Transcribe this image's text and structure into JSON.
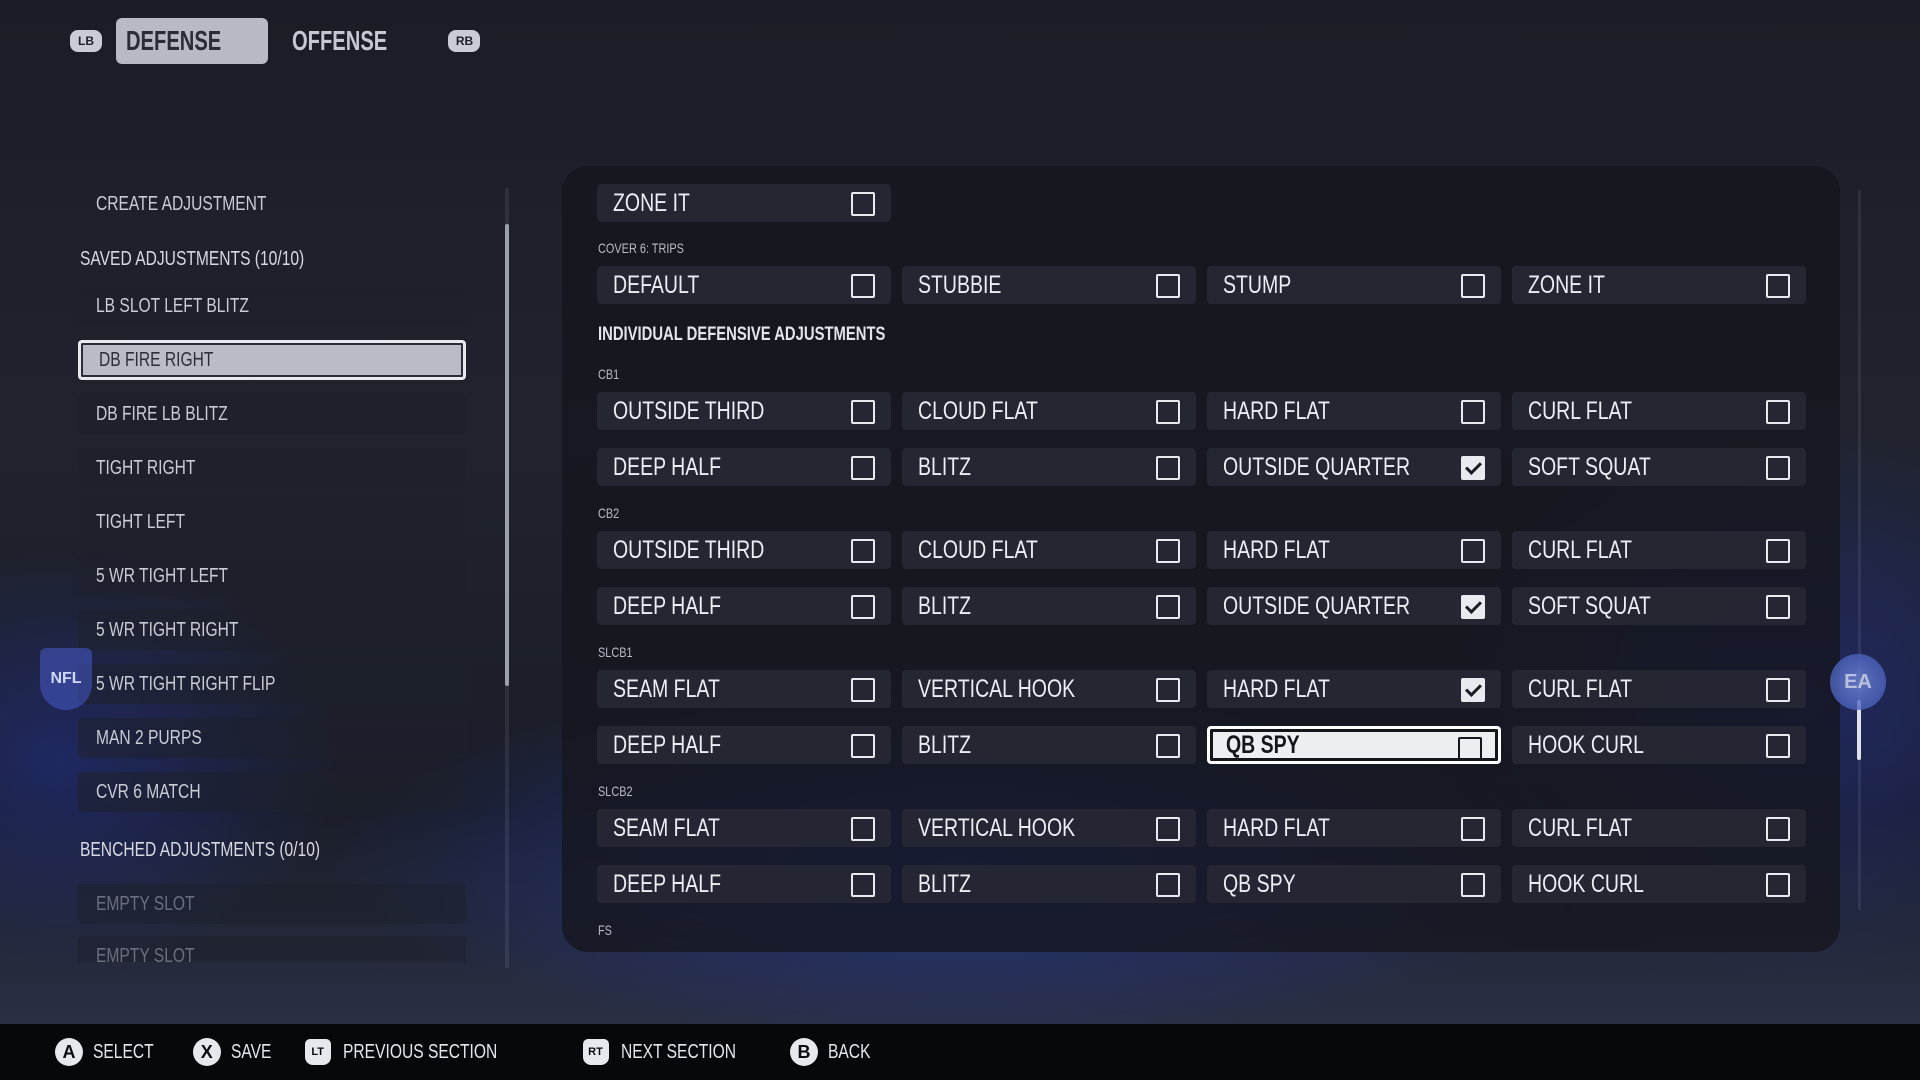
{
  "top_tabs": {
    "lb": "LB",
    "rb": "RB",
    "defense": "DEFENSE",
    "offense": "OFFENSE"
  },
  "left": {
    "create": "CREATE ADJUSTMENT",
    "saved_header": "SAVED ADJUSTMENTS (10/10)",
    "saved": [
      "LB SLOT LEFT BLITZ",
      "DB FIRE RIGHT",
      "DB FIRE LB BLITZ",
      "TIGHT RIGHT",
      "TIGHT LEFT",
      "5 WR TIGHT LEFT",
      "5 WR TIGHT RIGHT",
      "5 WR TIGHT RIGHT FLIP",
      "MAN 2 PURPS",
      "CVR 6 MATCH"
    ],
    "selected": "DB FIRE RIGHT",
    "benched_header": "BENCHED ADJUSTMENTS (0/10)",
    "benched": [
      "EMPTY SLOT",
      "EMPTY SLOT"
    ]
  },
  "main": {
    "r0": [
      {
        "label": "ZONE IT",
        "checked": false
      }
    ],
    "sec_cover6": "COVER 6: TRIPS",
    "r1": [
      {
        "label": "DEFAULT",
        "checked": false
      },
      {
        "label": "STUBBIE",
        "checked": false
      },
      {
        "label": "STUMP",
        "checked": false
      },
      {
        "label": "ZONE IT",
        "checked": false
      }
    ],
    "indiv_header": "INDIVIDUAL DEFENSIVE ADJUSTMENTS",
    "sec_cb1": "CB1",
    "r2": [
      {
        "label": "OUTSIDE THIRD",
        "checked": false
      },
      {
        "label": "CLOUD FLAT",
        "checked": false
      },
      {
        "label": "HARD FLAT",
        "checked": false
      },
      {
        "label": "CURL FLAT",
        "checked": false
      }
    ],
    "r3": [
      {
        "label": "DEEP HALF",
        "checked": false
      },
      {
        "label": "BLITZ",
        "checked": false
      },
      {
        "label": "OUTSIDE QUARTER",
        "checked": true
      },
      {
        "label": "SOFT SQUAT",
        "checked": false
      }
    ],
    "sec_cb2": "CB2",
    "r4": [
      {
        "label": "OUTSIDE THIRD",
        "checked": false
      },
      {
        "label": "CLOUD FLAT",
        "checked": false
      },
      {
        "label": "HARD FLAT",
        "checked": false
      },
      {
        "label": "CURL FLAT",
        "checked": false
      }
    ],
    "r5": [
      {
        "label": "DEEP HALF",
        "checked": false
      },
      {
        "label": "BLITZ",
        "checked": false
      },
      {
        "label": "OUTSIDE QUARTER",
        "checked": true
      },
      {
        "label": "SOFT SQUAT",
        "checked": false
      }
    ],
    "sec_slcb1": "SLCB1",
    "r6": [
      {
        "label": "SEAM FLAT",
        "checked": false
      },
      {
        "label": "VERTICAL HOOK",
        "checked": false
      },
      {
        "label": "HARD FLAT",
        "checked": true
      },
      {
        "label": "CURL FLAT",
        "checked": false
      }
    ],
    "r7": [
      {
        "label": "DEEP HALF",
        "checked": false
      },
      {
        "label": "BLITZ",
        "checked": false
      },
      {
        "label": "QB SPY",
        "checked": false
      },
      {
        "label": "HOOK CURL",
        "checked": false
      }
    ],
    "sec_slcb2": "SLCB2",
    "r8": [
      {
        "label": "SEAM FLAT",
        "checked": false
      },
      {
        "label": "VERTICAL HOOK",
        "checked": false
      },
      {
        "label": "HARD FLAT",
        "checked": false
      },
      {
        "label": "CURL FLAT",
        "checked": false
      }
    ],
    "r9": [
      {
        "label": "DEEP HALF",
        "checked": false
      },
      {
        "label": "BLITZ",
        "checked": false
      },
      {
        "label": "QB SPY",
        "checked": false
      },
      {
        "label": "HOOK CURL",
        "checked": false
      }
    ],
    "sec_fs": "FS",
    "focused": "QB SPY"
  },
  "logos": {
    "ea": "EA",
    "nfl": "NFL"
  },
  "hints": [
    {
      "button": "A",
      "label": "SELECT"
    },
    {
      "button": "X",
      "label": "SAVE"
    },
    {
      "button": "LT",
      "label": "PREVIOUS SECTION"
    },
    {
      "button": "RT",
      "label": "NEXT SECTION"
    },
    {
      "button": "B",
      "label": "BACK"
    }
  ]
}
